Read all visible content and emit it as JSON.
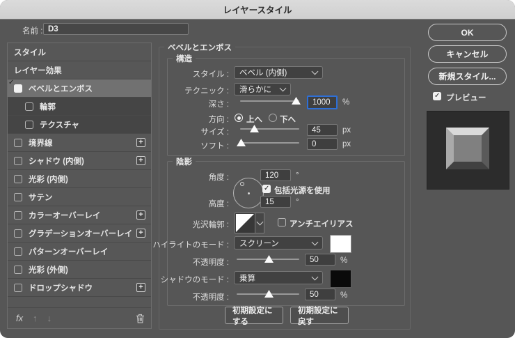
{
  "window": {
    "title": "レイヤースタイル"
  },
  "name_row": {
    "label": "名前 :",
    "value": "D3"
  },
  "sidebar": {
    "items": [
      {
        "label": "スタイル"
      },
      {
        "label": "レイヤー効果"
      },
      {
        "label": "ベベルとエンボス",
        "checked": true,
        "selected": true
      },
      {
        "label": "輪郭",
        "checked": false,
        "sub": true
      },
      {
        "label": "テクスチャ",
        "checked": false,
        "sub": true
      },
      {
        "label": "境界線",
        "checked": false,
        "plus": true
      },
      {
        "label": "シャドウ (内側)",
        "checked": false,
        "plus": true
      },
      {
        "label": "光彩 (内側)",
        "checked": false
      },
      {
        "label": "サテン",
        "checked": false
      },
      {
        "label": "カラーオーバーレイ",
        "checked": false,
        "plus": true
      },
      {
        "label": "グラデーションオーバーレイ",
        "checked": false,
        "plus": true
      },
      {
        "label": "パターンオーバーレイ",
        "checked": false
      },
      {
        "label": "光彩 (外側)",
        "checked": false
      },
      {
        "label": "ドロップシャドウ",
        "checked": false,
        "plus": true
      }
    ],
    "footer": {
      "fx": "fx",
      "plus_glyph": "+"
    }
  },
  "panel": {
    "section_title": "ベベルとエンボス",
    "structure": {
      "group_title": "構造",
      "style": {
        "label": "スタイル :",
        "value": "ベベル (内側)"
      },
      "technique": {
        "label": "テクニック :",
        "value": "滑らかに"
      },
      "depth": {
        "label": "深さ :",
        "value": "1000",
        "unit": "%"
      },
      "direction": {
        "label": "方向 :",
        "up": "上へ",
        "down": "下へ",
        "selected": "上へ"
      },
      "size": {
        "label": "サイズ :",
        "value": "45",
        "unit": "px"
      },
      "soften": {
        "label": "ソフト :",
        "value": "0",
        "unit": "px"
      }
    },
    "shading": {
      "group_title": "陰影",
      "angle": {
        "label": "角度 :",
        "value": "120",
        "unit": "°"
      },
      "use_global_light": {
        "label": "包括光源を使用",
        "checked": true
      },
      "altitude": {
        "label": "高度 :",
        "value": "15",
        "unit": "°"
      },
      "gloss_contour": {
        "label": "光沢輪郭 :"
      },
      "anti_aliased": {
        "label": "アンチエイリアス",
        "checked": false
      },
      "highlight_mode": {
        "label": "ハイライトのモード :",
        "value": "スクリーン",
        "swatch": "#ffffff"
      },
      "highlight_opacity": {
        "label": "不透明度 :",
        "value": "50",
        "unit": "%"
      },
      "shadow_mode": {
        "label": "シャドウのモード :",
        "value": "乗算",
        "swatch": "#0a0a0a"
      },
      "shadow_opacity": {
        "label": "不透明度 :",
        "value": "50",
        "unit": "%"
      }
    },
    "footer_buttons": {
      "make_default": "初期設定にする",
      "reset_default": "初期設定に戻す"
    }
  },
  "right": {
    "ok": "OK",
    "cancel": "キャンセル",
    "new_style": "新規スタイル...",
    "preview": {
      "label": "プレビュー",
      "checked": true
    }
  },
  "colors": {
    "focus_blue": "#2e6fd6",
    "highlight_swatch": "#ffffff",
    "shadow_swatch": "#0a0a0a"
  }
}
